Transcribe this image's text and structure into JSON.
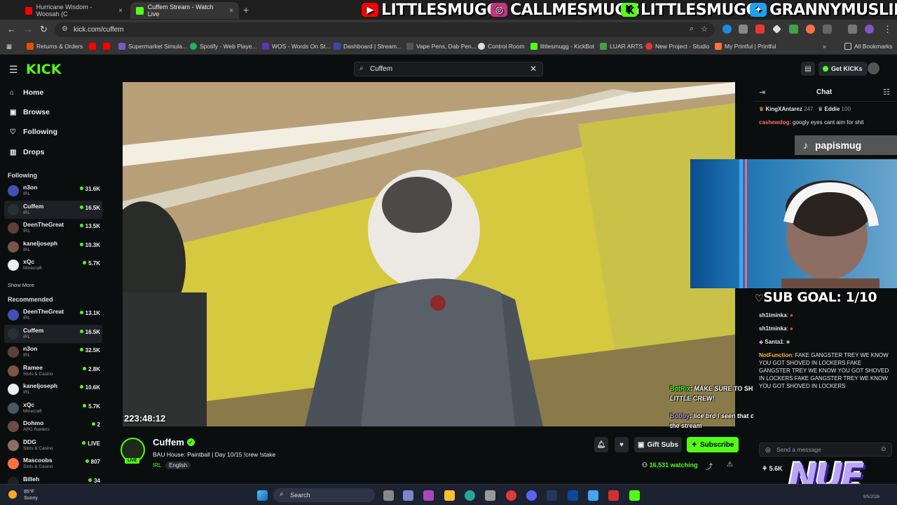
{
  "browser": {
    "tabs": [
      {
        "title": "Hurricane Wisdom - Woosah (C",
        "close": "×"
      },
      {
        "title": "Cuffem Stream - Watch Live",
        "close": "×"
      }
    ],
    "new_tab": "+",
    "url": "kick.com/cuffem",
    "bookmarks": [
      "Returns & Orders",
      "Supermarket Simula...",
      "Spotify - Web Playe...",
      "WOS - Words On St...",
      "Dashboard | Stream...",
      "Vape Pens, Dab Pen...",
      "Control Room",
      "littlesmugg - KickBot",
      "LUAR ARTS",
      "New Project - Studio",
      "My Printful | Printful"
    ],
    "all_bookmarks": "All Bookmarks"
  },
  "socials": [
    {
      "handle": "LITTLESMUGG",
      "icon": "youtube-icon",
      "color": "#ff0000"
    },
    {
      "handle": "CALLMESMUGG",
      "icon": "instagram-icon",
      "color": "#c13584"
    },
    {
      "handle": "LITTLESMUGG",
      "icon": "kick-icon",
      "color": "#53fc18"
    },
    {
      "handle": "GRANNYMUSLIM",
      "icon": "twitter-icon",
      "color": "#1da1f2"
    }
  ],
  "kick": {
    "logo": "KICK",
    "search_value": "Cuffem",
    "get_kicks": "Get KICKs",
    "nav": [
      {
        "label": "Home",
        "icon": "home-icon"
      },
      {
        "label": "Browse",
        "icon": "browse-icon"
      },
      {
        "label": "Following",
        "icon": "heart-icon"
      },
      {
        "label": "Drops",
        "icon": "drops-icon"
      }
    ],
    "following_heading": "Following",
    "following": [
      {
        "name": "n3on",
        "category": "IRL",
        "viewers": "31.6K"
      },
      {
        "name": "Cuffem",
        "category": "IRL",
        "viewers": "16.5K"
      },
      {
        "name": "DeenTheGreat",
        "category": "IRL",
        "viewers": "13.5K"
      },
      {
        "name": "kaneljoseph",
        "category": "IRL",
        "viewers": "10.3K"
      },
      {
        "name": "xQc",
        "category": "Minecraft",
        "viewers": "5.7K"
      }
    ],
    "show_more": "Show More",
    "recommended_heading": "Recommended",
    "recommended": [
      {
        "name": "DeenTheGreat",
        "category": "IRL",
        "viewers": "13.1K"
      },
      {
        "name": "Cuffem",
        "category": "IRL",
        "viewers": "16.5K"
      },
      {
        "name": "n3on",
        "category": "IRL",
        "viewers": "32.5K"
      },
      {
        "name": "Ramee",
        "category": "Slots & Casino",
        "viewers": "2.8K"
      },
      {
        "name": "kaneljoseph",
        "category": "IRL",
        "viewers": "10.6K"
      },
      {
        "name": "xQc",
        "category": "Minecraft",
        "viewers": "5.7K"
      },
      {
        "name": "Dohmo",
        "category": "ARC Raiders",
        "viewers": "2"
      },
      {
        "name": "DDG",
        "category": "Slots & Casino",
        "viewers": "LIVE"
      },
      {
        "name": "Mascoobs",
        "category": "Slots & Casino",
        "viewers": "807"
      },
      {
        "name": "Billeh",
        "category": "",
        "viewers": "34"
      }
    ]
  },
  "stream": {
    "timer": "223:48:12",
    "channel": "Cuffem",
    "live": "LIVE",
    "title": "BAU House: Paintball | Day 10/15  !crew !stake",
    "category": "IRL",
    "language": "English",
    "gift_subs": "Gift Subs",
    "subscribe": "Subscribe",
    "watching": "16,531 watching"
  },
  "chat": {
    "title": "Chat",
    "leaders": [
      {
        "name": "KingXAntarez",
        "count": "247"
      },
      {
        "name": "Eddie",
        "count": "100"
      }
    ],
    "messages": [
      {
        "user": "cashewdog",
        "text": "googly eyes cant aim for shit",
        "color": "#ff6b6b"
      },
      {
        "user": "sh1tminka",
        "text": "",
        "color": "#e5e5e5"
      },
      {
        "user": "sh1tminka",
        "text": "",
        "color": "#e5e5e5"
      },
      {
        "user": "Santa1",
        "text": "",
        "color": "#e5e5e5"
      },
      {
        "user": "NotFunction",
        "text": "FAKE GANGSTER TREY WE KNOW YOU GOT SHOVED IN LOCKERS FAKE GANGSTER TREY WE KNOW YOU GOT SHOVED IN LOCKERS FAKE GANGSTER TREY WE KNOW YOU GOT SHOVED IN LOCKERS",
        "color": "#ffb347"
      }
    ],
    "input_placeholder": "Send a message",
    "viewer_count": "5.6K"
  },
  "overlay": {
    "tiktok_handle": "papismug",
    "sub_goal": "SUB GOAL: 1/10",
    "botrix_user": "BotRix",
    "botrix_msg": "MAKE SURE TO SHARE THE STREAM AND BE APART OF THE LITTLE CREW!",
    "bobby_user": "Bobby",
    "bobby_msg": "lice bro I seen that damn trips on his head from the thumbnail of the stream",
    "logo": "NUE"
  },
  "taskbar": {
    "search": "Search",
    "temp": "85°F",
    "weather": "Sunny",
    "date": "8/5/2026"
  }
}
